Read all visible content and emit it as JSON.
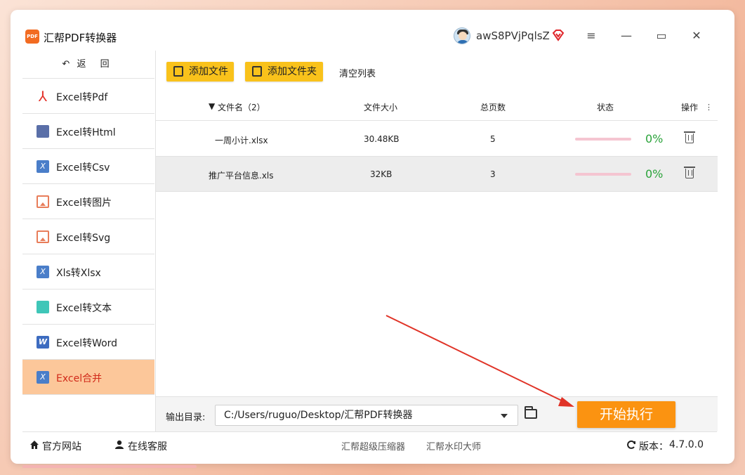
{
  "app": {
    "title": "汇帮PDF转换器",
    "logo_text": "PDF",
    "username": "awS8PVjPqlsZ",
    "accent_color": "#fb9311"
  },
  "window_controls": {
    "menu_icon": "≡",
    "minimize_icon": "—",
    "maximize_icon": "▭",
    "close_icon": "✕"
  },
  "sidebar": {
    "back_label": "返 回",
    "back_icon": "↶",
    "items": [
      {
        "label": "Excel转Pdf",
        "icon": "pdf-icon"
      },
      {
        "label": "Excel转Html",
        "icon": "html-icon"
      },
      {
        "label": "Excel转Csv",
        "icon": "csv-icon"
      },
      {
        "label": "Excel转图片",
        "icon": "image-icon"
      },
      {
        "label": "Excel转Svg",
        "icon": "svg-icon"
      },
      {
        "label": "Xls转Xlsx",
        "icon": "xlsx-icon"
      },
      {
        "label": "Excel转文本",
        "icon": "text-icon"
      },
      {
        "label": "Excel转Word",
        "icon": "word-icon"
      },
      {
        "label": "Excel合并",
        "icon": "merge-icon",
        "active": true
      }
    ]
  },
  "toolbar": {
    "add_file": "添加文件",
    "add_folder": "添加文件夹",
    "clear_list": "清空列表"
  },
  "table": {
    "headers": {
      "filename": "文件名（2）",
      "size": "文件大小",
      "pages": "总页数",
      "status": "状态",
      "actions": "操作"
    },
    "rows": [
      {
        "filename": "一周小计.xlsx",
        "size": "30.48KB",
        "pages": "5",
        "progress": 0,
        "percent": "0%"
      },
      {
        "filename": "推广平台信息.xls",
        "size": "32KB",
        "pages": "3",
        "progress": 0,
        "percent": "0%"
      }
    ]
  },
  "output": {
    "label": "输出目录:",
    "path": "C:/Users/ruguo/Desktop/汇帮PDF转换器",
    "start_button": "开始执行"
  },
  "footer": {
    "website": "官方网站",
    "support": "在线客服",
    "link1": "汇帮超级压缩器",
    "link2": "汇帮水印大师",
    "version_label": "版本：",
    "version": "4.7.0.0"
  }
}
